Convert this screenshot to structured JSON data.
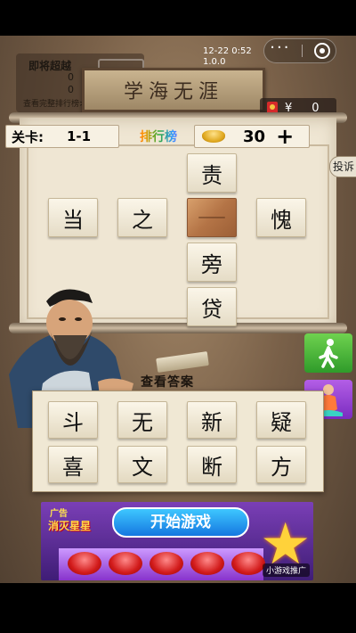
{
  "status": {
    "time": "12-22 0:52",
    "version": "1.0.0"
  },
  "capsule": {
    "more_icon": "more-icon",
    "close_icon": "target-icon"
  },
  "score_panel": {
    "title": "即将超越",
    "value_1": "0",
    "value_2": "0",
    "rank_link": "查看完整排行榜>>"
  },
  "plaque": {
    "text": "学海无涯"
  },
  "red_packet": {
    "currency": "¥",
    "amount": "0"
  },
  "header": {
    "level_label": "关卡:",
    "level_value": "1-1",
    "rank_label": "排行榜",
    "coins": "30",
    "add_coins": "+"
  },
  "report_label": "投诉",
  "puzzle": {
    "tiles": [
      "责",
      "当",
      "之",
      "",
      "愧",
      "旁",
      "贷"
    ]
  },
  "view_answer": "查看答案",
  "choices": [
    "斗",
    "无",
    "新",
    "疑",
    "喜",
    "文",
    "断",
    "方"
  ],
  "ad": {
    "label": "广告",
    "logo": "消灭星星",
    "play_button": "开始游戏",
    "promo": "小游戏推广"
  },
  "colors": {
    "accent_green": "#3aa832",
    "accent_purple": "#8a3ccf",
    "paper": "#efe6d3"
  }
}
